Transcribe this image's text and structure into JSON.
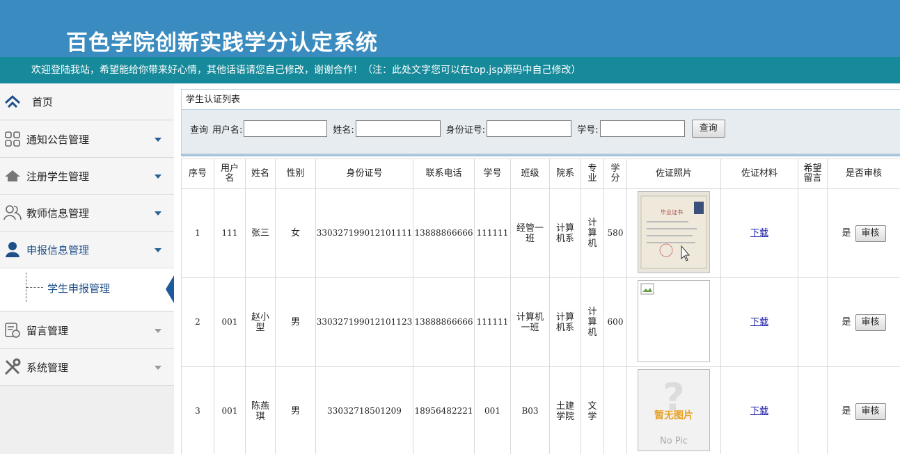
{
  "header": {
    "title": "百色学院创新实践学分认定系统"
  },
  "welcome": "欢迎登陆我站，希望能给你带来好心情，其他话语请您自己修改，谢谢合作！（注：此处文字您可以在top.jsp源码中自己修改）",
  "sidebar": {
    "items": [
      {
        "label": "首页",
        "icon": "home-icon"
      },
      {
        "label": "通知公告管理",
        "icon": "grid-icon"
      },
      {
        "label": "注册学生管理",
        "icon": "house-icon"
      },
      {
        "label": "教师信息管理",
        "icon": "users-icon"
      },
      {
        "label": "申报信息管理",
        "icon": "user-icon"
      },
      {
        "label": "留言管理",
        "icon": "message-icon"
      },
      {
        "label": "系统管理",
        "icon": "tools-icon"
      }
    ],
    "submenu": {
      "label": "学生申报管理"
    }
  },
  "panel": {
    "title": "学生认证列表"
  },
  "search": {
    "query_label": "查询",
    "username_label": "用户名:",
    "name_label": "姓名:",
    "idcard_label": "身份证号:",
    "studentno_label": "学号:",
    "button": "查询"
  },
  "table": {
    "headers": [
      "序号",
      "用户名",
      "姓名",
      "性别",
      "身份证号",
      "联系电话",
      "学号",
      "班级",
      "院系",
      "专业",
      "学分",
      "佐证照片",
      "佐证材料",
      "希望留言",
      "是否审核"
    ],
    "rows": [
      {
        "no": "1",
        "username": "111",
        "name": "张三",
        "gender": "女",
        "idcard": "330327199012101111",
        "phone": "13888866666",
        "studentno": "111111",
        "class": "经管一班",
        "dept": "计算机系",
        "major": "计算机",
        "credit": "580",
        "material": "下载",
        "message": "",
        "reviewed": "是",
        "action": "审核"
      },
      {
        "no": "2",
        "username": "001",
        "name": "赵小型",
        "gender": "男",
        "idcard": "330327199012101123",
        "phone": "13888866666",
        "studentno": "111111",
        "class": "计算机一班",
        "dept": "计算机系",
        "major": "计算机",
        "credit": "600",
        "material": "下载",
        "message": "",
        "reviewed": "是",
        "action": "审核"
      },
      {
        "no": "3",
        "username": "001",
        "name": "陈燕琪",
        "gender": "男",
        "idcard": "33032718501209",
        "phone": "18956482221",
        "studentno": "001",
        "class": "B03",
        "dept": "土建学院",
        "major": "文学",
        "credit": "",
        "material": "下载",
        "message": "",
        "reviewed": "是",
        "action": "审核"
      }
    ],
    "photos": {
      "cert_title": "毕业证书",
      "nopic_text": "暂无图片",
      "nopic_sub": "No Pic"
    }
  },
  "colors": {
    "header": "#3a8bbf",
    "welcome_bar": "#16899a",
    "sidebar_active": "#1d4f88"
  }
}
